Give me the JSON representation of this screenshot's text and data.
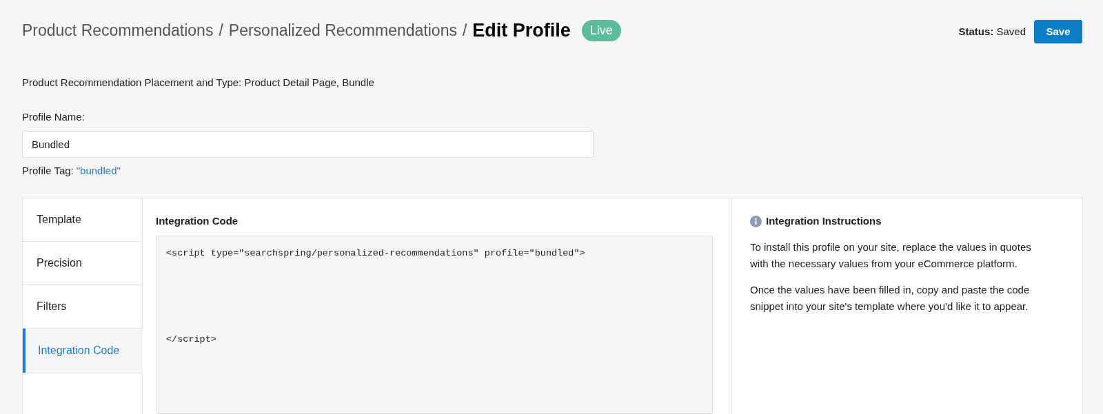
{
  "breadcrumb": [
    {
      "label": "Product Recommendations",
      "separator": "/"
    },
    {
      "label": "Personalized Recommendations",
      "separator": "/"
    }
  ],
  "title": "Edit Profile",
  "badge": "Live",
  "status": {
    "label": "Status:",
    "value": "Saved"
  },
  "save_button": "Save",
  "placement": "Product Recommendation Placement and Type: Product Detail Page, Bundle",
  "profile_name": {
    "label": "Profile Name:",
    "value": "Bundled"
  },
  "profile_tag": {
    "label": "Profile Tag:",
    "value": "\"bundled\""
  },
  "tabs": [
    {
      "label": "Template",
      "selected": false
    },
    {
      "label": "Precision",
      "selected": false
    },
    {
      "label": "Filters",
      "selected": false
    },
    {
      "label": "Integration Code",
      "selected": true
    }
  ],
  "integration_code": {
    "heading": "Integration Code",
    "opening_tag": "<script type=\"searchspring/personalized-recommendations\" profile=\"bundled\">",
    "closing_tag": "</script>"
  },
  "instructions": {
    "heading": "Integration Instructions",
    "paragraphs": [
      "To install this profile on your site, replace the values in quotes with the necessary values from your eCommerce platform.",
      "Once the values have been filled in, copy and paste the code snippet into your site's template where you'd like it to appear."
    ]
  }
}
